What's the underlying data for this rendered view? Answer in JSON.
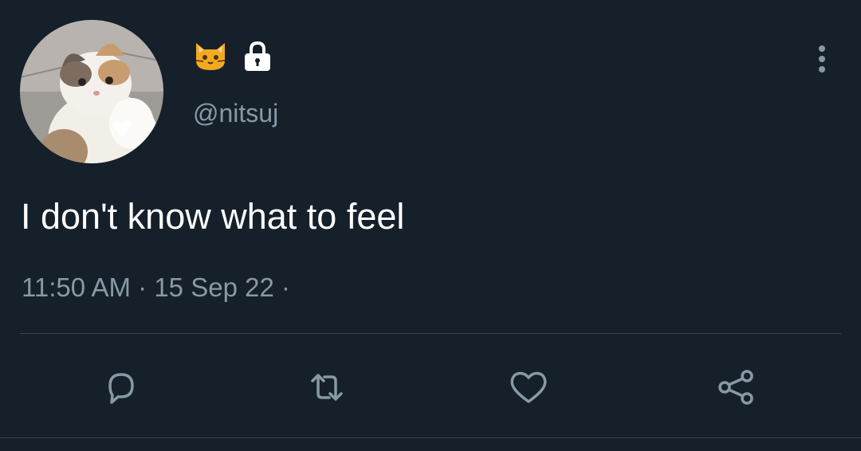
{
  "tweet": {
    "handle": "@nitsuj",
    "text": "I don't know what to feel",
    "time": "11:50 AM",
    "separator": "·",
    "date": "15 Sep 22",
    "trailing_separator": "·"
  },
  "icons": {
    "name_emoji": "cat-face-icon",
    "protected": "lock-icon",
    "more": "more-vertical-icon",
    "reply": "reply-icon",
    "retweet": "retweet-icon",
    "like": "heart-icon",
    "share": "share-icon"
  },
  "colors": {
    "background": "#15202b",
    "text_primary": "#ffffff",
    "text_secondary": "#8899a6",
    "divider": "#38444d"
  }
}
